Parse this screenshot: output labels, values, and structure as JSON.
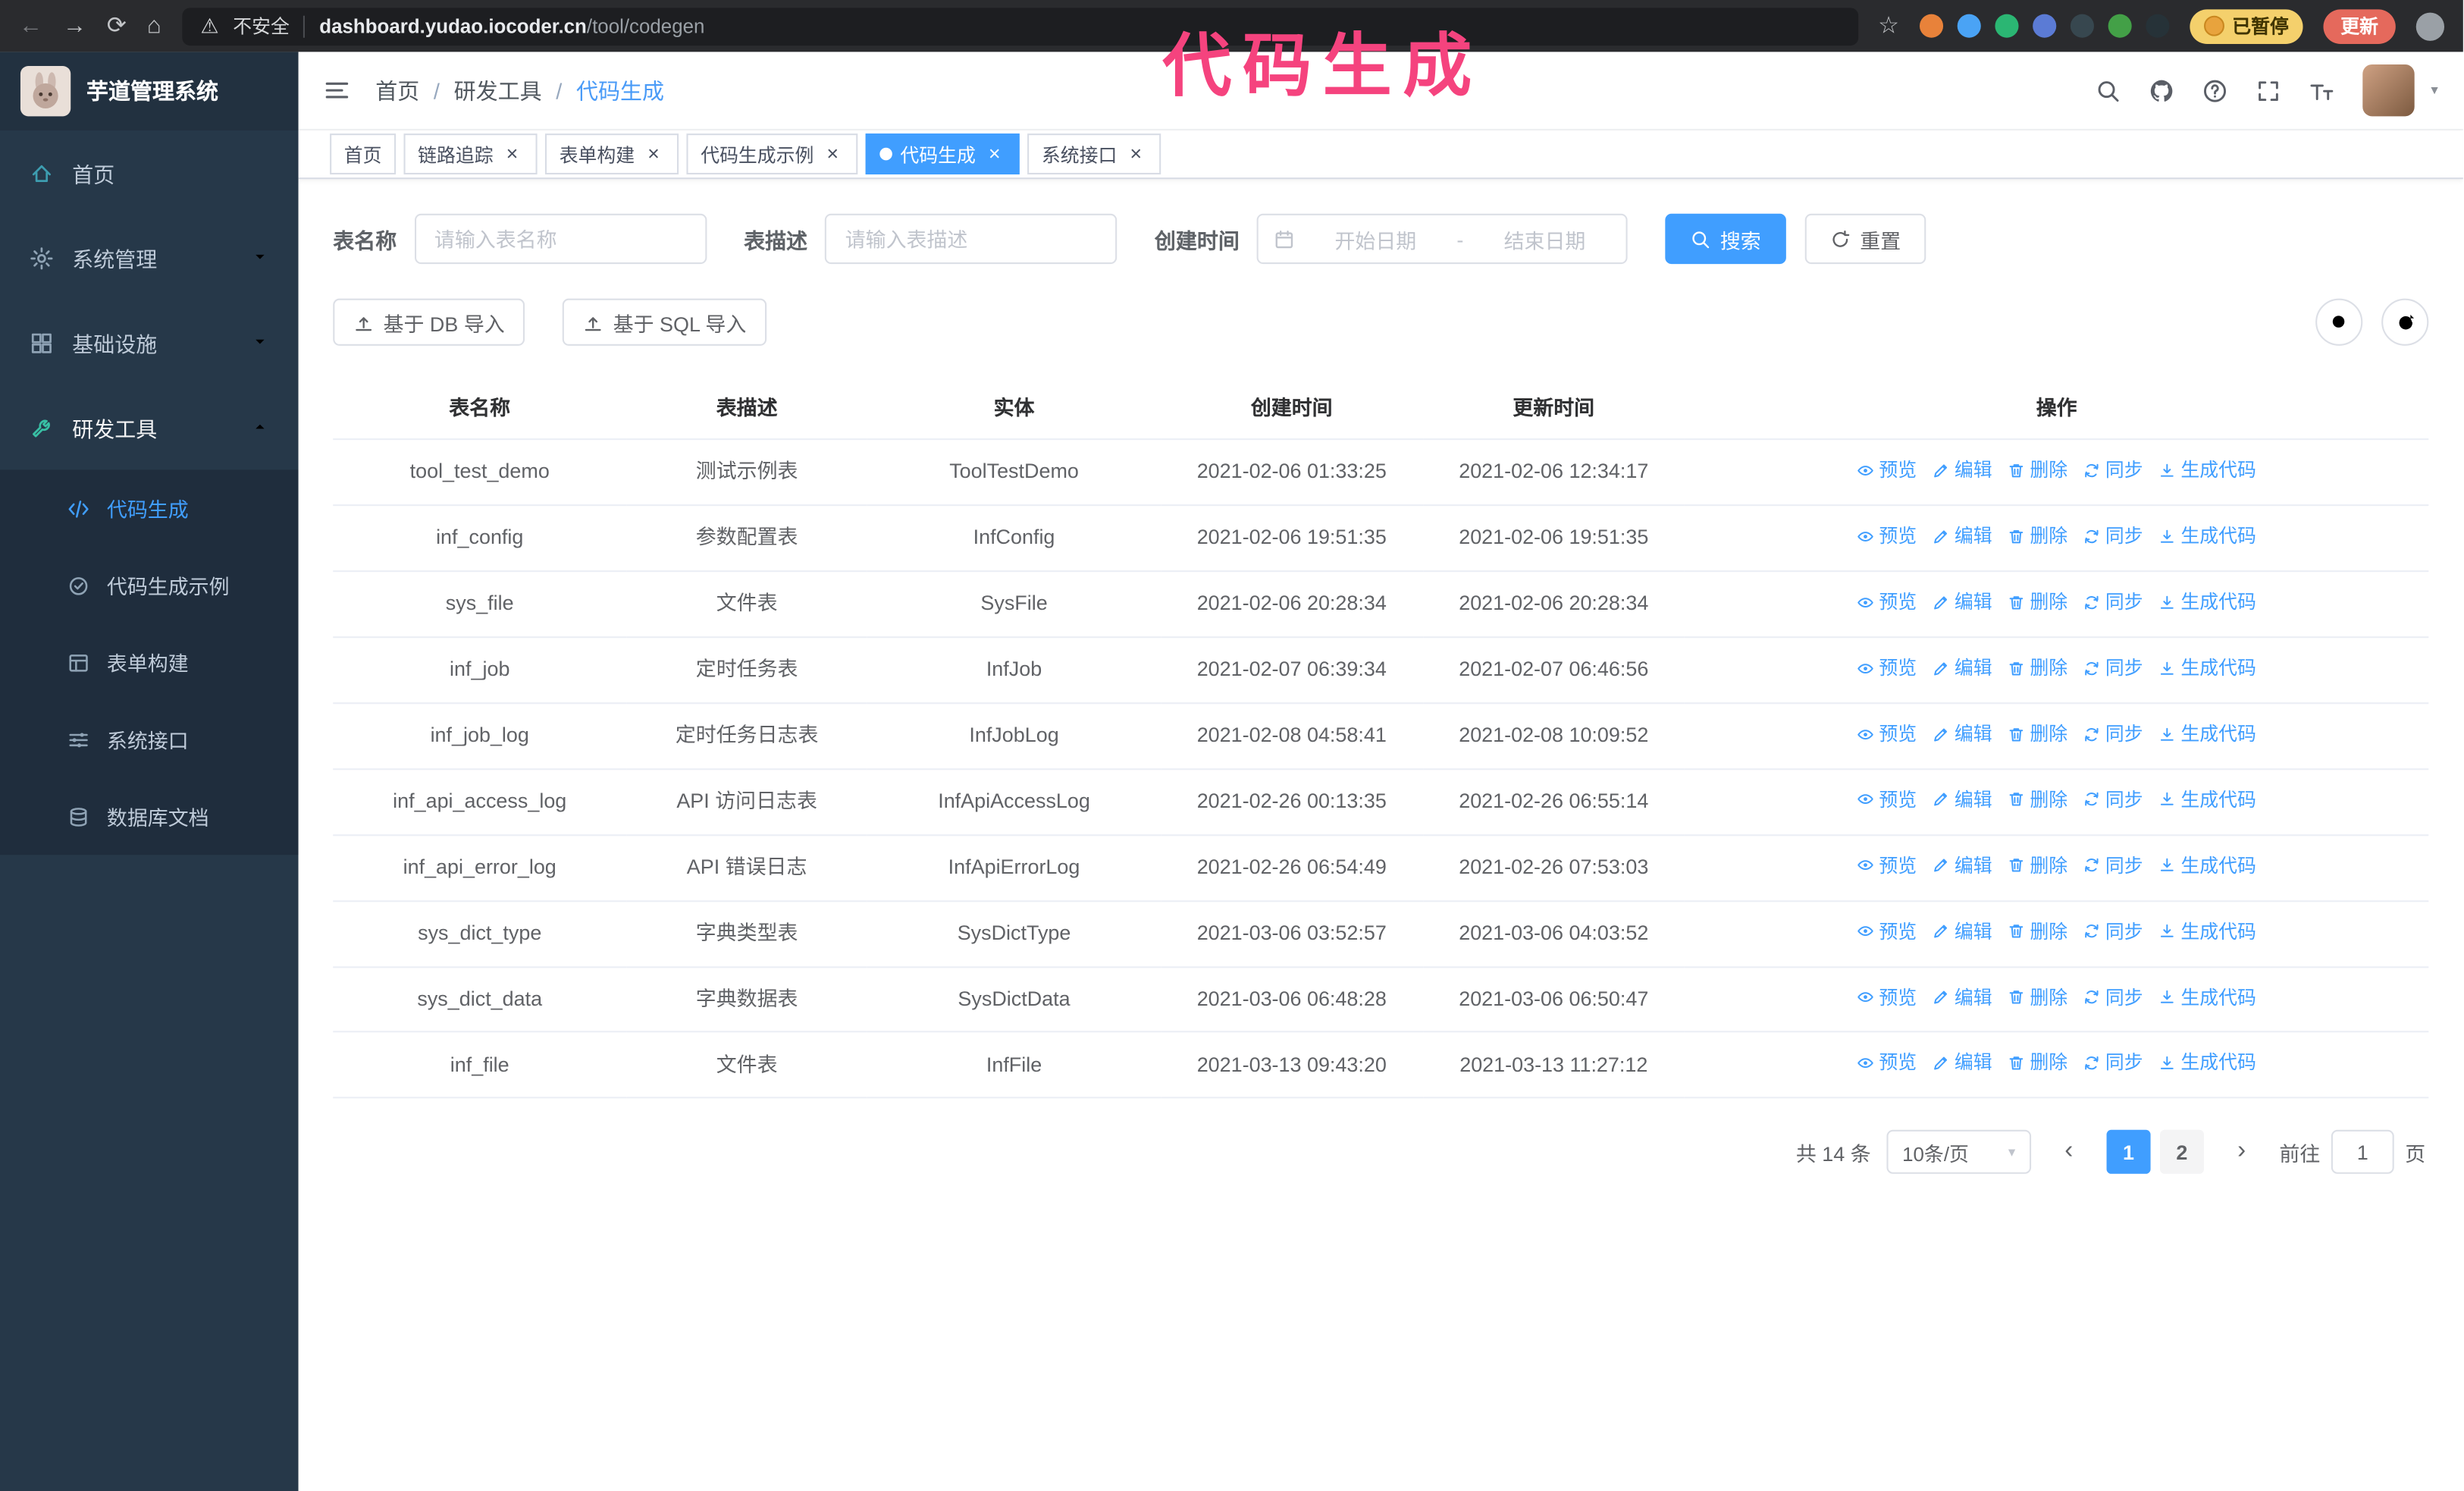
{
  "annotation": {
    "text": "代码生成"
  },
  "browser": {
    "security_warning": "不安全",
    "url_domain": "dashboard.yudao.iocoder.cn",
    "url_path": "/tool/codegen",
    "extension_colors": [
      "#e8823a",
      "#4aa3f5",
      "#2bb673",
      "#5b7bd5",
      "#37474f",
      "#43a047",
      "#263238"
    ],
    "paused_badge": "已暂停",
    "update_button": "更新"
  },
  "sidebar": {
    "logo_title": "芋道管理系统",
    "items": [
      {
        "label": "首页",
        "icon": "home"
      },
      {
        "label": "系统管理",
        "icon": "gear",
        "chevron": "down"
      },
      {
        "label": "基础设施",
        "icon": "grid",
        "chevron": "down"
      },
      {
        "label": "研发工具",
        "icon": "wrench",
        "chevron": "up",
        "expanded": true
      }
    ],
    "subitems": [
      {
        "label": "代码生成",
        "icon": "code",
        "active": true
      },
      {
        "label": "代码生成示例",
        "icon": "badge"
      },
      {
        "label": "表单构建",
        "icon": "form"
      },
      {
        "label": "系统接口",
        "icon": "sliders"
      },
      {
        "label": "数据库文档",
        "icon": "db"
      }
    ]
  },
  "header": {
    "breadcrumb": [
      "首页",
      "研发工具",
      "代码生成"
    ]
  },
  "tabs": [
    {
      "label": "首页",
      "closable": false
    },
    {
      "label": "链路追踪",
      "closable": true
    },
    {
      "label": "表单构建",
      "closable": true
    },
    {
      "label": "代码生成示例",
      "closable": true
    },
    {
      "label": "代码生成",
      "closable": true,
      "active": true
    },
    {
      "label": "系统接口",
      "closable": true
    }
  ],
  "filters": {
    "table_name_label": "表名称",
    "table_name_placeholder": "请输入表名称",
    "table_desc_label": "表描述",
    "table_desc_placeholder": "请输入表描述",
    "create_time_label": "创建时间",
    "start_date_placeholder": "开始日期",
    "range_separator": "-",
    "end_date_placeholder": "结束日期",
    "search_button": "搜索",
    "reset_button": "重置"
  },
  "toolbar": {
    "import_db": "基于 DB 导入",
    "import_sql": "基于 SQL 导入"
  },
  "table": {
    "columns": [
      "表名称",
      "表描述",
      "实体",
      "创建时间",
      "更新时间",
      "操作"
    ],
    "actions": [
      {
        "label": "预览",
        "icon": "eye"
      },
      {
        "label": "编辑",
        "icon": "edit"
      },
      {
        "label": "删除",
        "icon": "trash"
      },
      {
        "label": "同步",
        "icon": "sync"
      },
      {
        "label": "生成代码",
        "icon": "download"
      }
    ],
    "rows": [
      {
        "name": "tool_test_demo",
        "desc": "测试示例表",
        "entity": "ToolTestDemo",
        "created": "2021-02-06 01:33:25",
        "updated": "2021-02-06 12:34:17"
      },
      {
        "name": "inf_config",
        "desc": "参数配置表",
        "entity": "InfConfig",
        "created": "2021-02-06 19:51:35",
        "updated": "2021-02-06 19:51:35"
      },
      {
        "name": "sys_file",
        "desc": "文件表",
        "entity": "SysFile",
        "created": "2021-02-06 20:28:34",
        "updated": "2021-02-06 20:28:34"
      },
      {
        "name": "inf_job",
        "desc": "定时任务表",
        "entity": "InfJob",
        "created": "2021-02-07 06:39:34",
        "updated": "2021-02-07 06:46:56"
      },
      {
        "name": "inf_job_log",
        "desc": "定时任务日志表",
        "entity": "InfJobLog",
        "created": "2021-02-08 04:58:41",
        "updated": "2021-02-08 10:09:52"
      },
      {
        "name": "inf_api_access_log",
        "desc": "API 访问日志表",
        "entity": "InfApiAccessLog",
        "created": "2021-02-26 00:13:35",
        "updated": "2021-02-26 06:55:14"
      },
      {
        "name": "inf_api_error_log",
        "desc": "API 错误日志",
        "entity": "InfApiErrorLog",
        "created": "2021-02-26 06:54:49",
        "updated": "2021-02-26 07:53:03"
      },
      {
        "name": "sys_dict_type",
        "desc": "字典类型表",
        "entity": "SysDictType",
        "created": "2021-03-06 03:52:57",
        "updated": "2021-03-06 04:03:52"
      },
      {
        "name": "sys_dict_data",
        "desc": "字典数据表",
        "entity": "SysDictData",
        "created": "2021-03-06 06:48:28",
        "updated": "2021-03-06 06:50:47"
      },
      {
        "name": "inf_file",
        "desc": "文件表",
        "entity": "InfFile",
        "created": "2021-03-13 09:43:20",
        "updated": "2021-03-13 11:27:12"
      }
    ]
  },
  "pagination": {
    "total": "共 14 条",
    "page_size": "10条/页",
    "pages": [
      "1",
      "2"
    ],
    "active_page": "1",
    "goto_label": "前往",
    "goto_value": "1",
    "goto_suffix": "页"
  }
}
